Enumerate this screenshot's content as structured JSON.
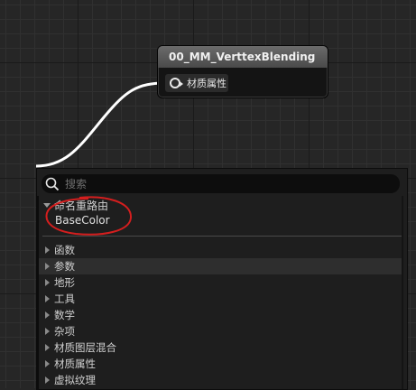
{
  "node": {
    "title": "00_MM_VerttexBlending",
    "pin_label": "材质属性",
    "pin_icon": "output-pin-icon"
  },
  "menu": {
    "search": {
      "placeholder": "搜索"
    },
    "open_category": "命名重路由",
    "open_items": [
      "BaseColor"
    ],
    "categories": [
      "函数",
      "参数",
      "地形",
      "工具",
      "数学",
      "杂项",
      "材质图层混合",
      "材质属性",
      "虚拟纹理"
    ]
  },
  "colors": {
    "wire": "#ffffff",
    "annotation": "#d41e1e",
    "hovered_row": "#2e2e2e"
  }
}
